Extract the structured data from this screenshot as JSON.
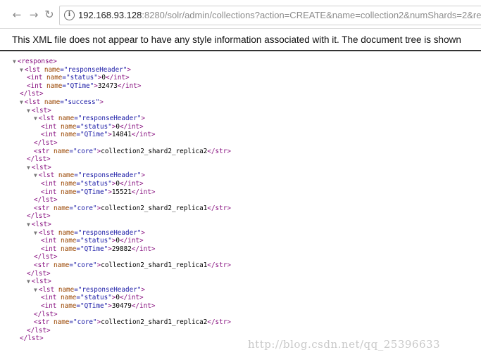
{
  "browser": {
    "url_host": "192.168.93.128",
    "url_rest": ":8280/solr/admin/collections?action=CREATE&name=collection2&numShards=2&replicat"
  },
  "banner": "This XML file does not appear to have any style information associated with it. The document tree is shown",
  "watermark": "http://blog.csdn.net/qq_25396633",
  "tree": {
    "response": "response",
    "lst": "lst",
    "int": "int",
    "str": "str",
    "name_attr": "name",
    "responseHeader": "responseHeader",
    "status": "status",
    "qtime": "QTime",
    "success": "success",
    "core": "core",
    "root_status": "0",
    "root_qtime": "32473",
    "shards": [
      {
        "status": "0",
        "qtime": "14841",
        "core": "collection2_shard2_replica2"
      },
      {
        "status": "0",
        "qtime": "15521",
        "core": "collection2_shard2_replica1"
      },
      {
        "status": "0",
        "qtime": "29882",
        "core": "collection2_shard1_replica1"
      },
      {
        "status": "0",
        "qtime": "30479",
        "core": "collection2_shard1_replica2"
      }
    ]
  }
}
